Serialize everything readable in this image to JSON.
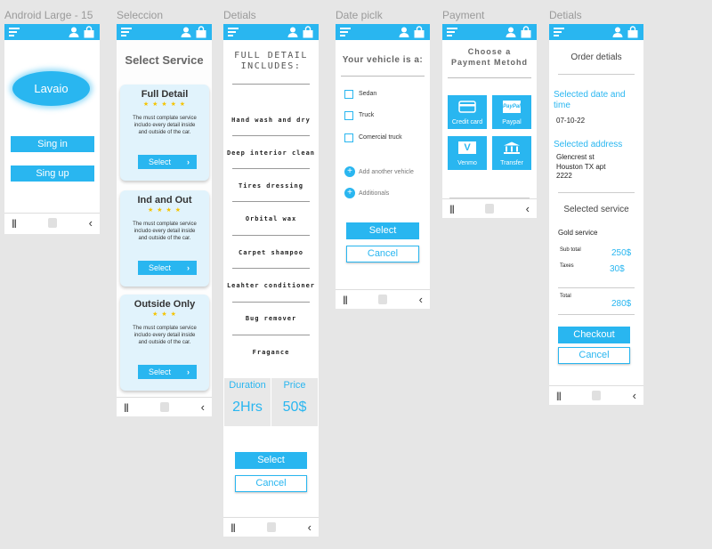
{
  "colors": {
    "accent": "#29b6f0",
    "card_bg": "#e1f3fc",
    "star": "#f5c400",
    "canvas": "#e6e6e6"
  },
  "frames": {
    "login": "Android Large - 15",
    "selection": "Seleccion",
    "details": "Detials",
    "date_pick": "Date piclk",
    "payment": "Payment",
    "order_details": "Detials"
  },
  "login": {
    "logo": "Lavaio",
    "sign_in": "Sing in",
    "sign_up": "Sing up"
  },
  "selection": {
    "title": "Select Service",
    "cards": [
      {
        "title": "Full Detail",
        "stars": "★ ★ ★ ★ ★",
        "desc": "The must complate service includo every detail inside and outside of the car.",
        "button": "Select"
      },
      {
        "title": "Ind and Out",
        "stars": "★ ★ ★ ★",
        "desc": "The must complate service includo every detail inside and outside of the car.",
        "button": "Select"
      },
      {
        "title": "Outside Only",
        "stars": "★ ★ ★",
        "desc": "The must complate service includo every detail inside and outside of the car.",
        "button": "Select"
      }
    ]
  },
  "details": {
    "title_line1": "FULL DETAIL",
    "title_line2": "INCLUDES:",
    "features": [
      "Hand wash and dry",
      "Deep interior clean",
      "Tires dressing",
      "Orbital wax",
      "Carpet shampoo",
      "Leahter conditioner",
      "Bug remover",
      "Fragance"
    ],
    "duration_label": "Duration",
    "duration_value": "2Hrs",
    "price_label": "Price",
    "price_value": "50$",
    "select": "Select",
    "cancel": "Cancel"
  },
  "date_pick": {
    "title": "Your vehicle is a:",
    "vehicles": [
      "Sedan",
      "Truck",
      "Comercial truck"
    ],
    "add_vehicle": "Add another vehicle",
    "additionals": "Additionals",
    "select": "Select",
    "cancel": "Cancel"
  },
  "payment": {
    "title_line1": "Choose a",
    "title_line2": "Payment Metohd",
    "methods": [
      {
        "label": "Credit card",
        "icon": "credit-card-icon"
      },
      {
        "label": "Paypal",
        "icon": "paypal-icon",
        "icon_text": "PayPal"
      },
      {
        "label": "Venmo",
        "icon": "venmo-icon",
        "icon_text": "V"
      },
      {
        "label": "Transfer",
        "icon": "bank-icon"
      }
    ]
  },
  "order": {
    "title": "Order detials",
    "date_label_1": "Selected date and",
    "date_label_2": "time",
    "date_value": "07-10-22",
    "address_label": "Selected address",
    "address_line1": "Glencrest st",
    "address_line2": "Houston TX apt",
    "address_line3": "2222",
    "service_label": "Selected service",
    "service_name": "Gold service",
    "subtotal_label": "Sub total",
    "subtotal_value": "250$",
    "taxes_label": "Taxes",
    "taxes_value": "30$",
    "total_label": "Total",
    "total_value": "280$",
    "checkout": "Checkout",
    "cancel": "Cancel"
  },
  "navbar": {
    "recent": "|||",
    "back": "‹"
  }
}
